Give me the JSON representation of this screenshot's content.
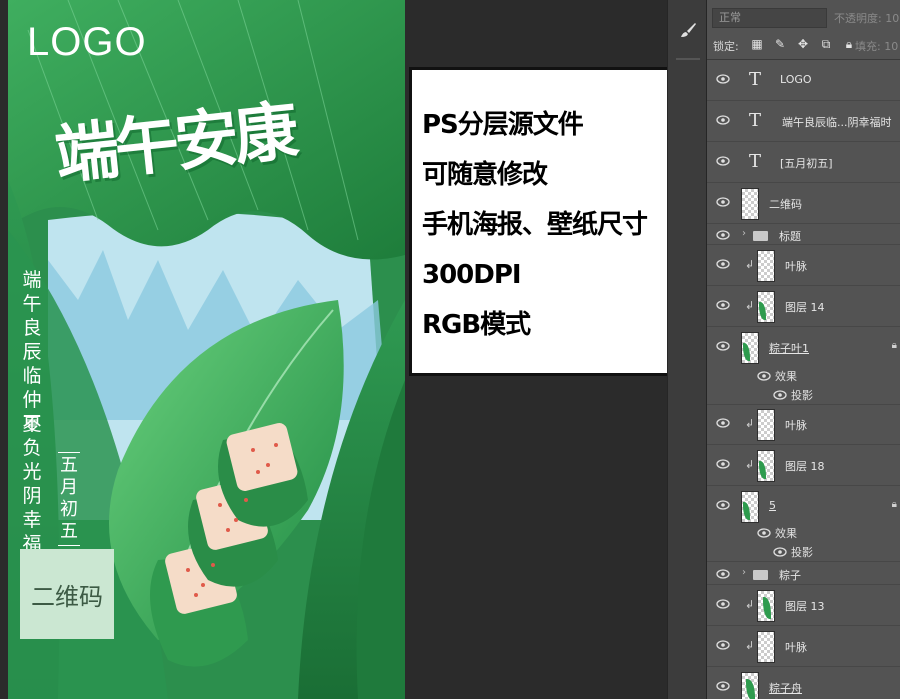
{
  "poster": {
    "logo": "LOGO",
    "title": "端午安康",
    "vertical_line1": "端午良辰临仲夏",
    "vertical_line2": "不负光阴幸福时",
    "date": "五月初五",
    "qr_placeholder": "二维码",
    "colors": {
      "leaf_dark": "#1f7a3c",
      "leaf_mid": "#2fa257",
      "leaf_light": "#4fc46e",
      "water": "#bfe4ef",
      "qr_bg": "#cbe7d2"
    }
  },
  "info": {
    "lines": [
      "PS分层源文件",
      "可随意修改",
      "手机海报、壁纸尺寸",
      "300DPI",
      "RGB模式"
    ]
  },
  "toolbar": {
    "brush_icon": "brush-icon"
  },
  "panel": {
    "blend_mode": "正常",
    "opacity_label": "不透明度: 10",
    "lock_label": "锁定:",
    "fill_label": "填充: 10"
  },
  "layers": [
    {
      "kind": "text",
      "name": "LOGO"
    },
    {
      "kind": "text",
      "name": "端午良辰临...阴幸福时"
    },
    {
      "kind": "text",
      "name": "[五月初五]"
    },
    {
      "kind": "pixel",
      "name": "二维码"
    },
    {
      "kind": "group",
      "name": "标题"
    },
    {
      "kind": "pixel",
      "name": "叶脉",
      "clipped": true
    },
    {
      "kind": "pixel",
      "name": "图层 14",
      "clipped": true
    },
    {
      "kind": "pixel",
      "name": "粽子叶1",
      "locked": true
    },
    {
      "kind": "effect",
      "name": "效果"
    },
    {
      "kind": "effect",
      "name": "投影"
    },
    {
      "kind": "pixel",
      "name": "叶脉",
      "clipped": true
    },
    {
      "kind": "pixel",
      "name": "图层 18",
      "clipped": true
    },
    {
      "kind": "pixel",
      "name": "5",
      "locked": true
    },
    {
      "kind": "effect",
      "name": "效果"
    },
    {
      "kind": "effect",
      "name": "投影"
    },
    {
      "kind": "group",
      "name": "粽子"
    },
    {
      "kind": "pixel",
      "name": "图层 13",
      "clipped": true
    },
    {
      "kind": "pixel",
      "name": "叶脉",
      "clipped": true
    },
    {
      "kind": "pixel",
      "name": "粽子舟"
    }
  ]
}
